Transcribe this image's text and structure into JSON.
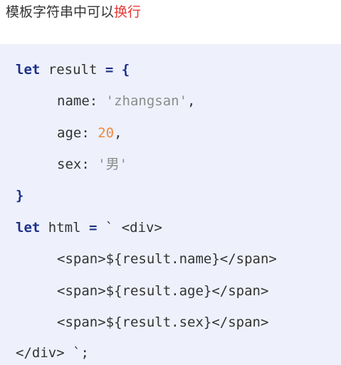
{
  "heading": {
    "prefix": "模板字符串中可以",
    "highlight": "换行"
  },
  "code": {
    "line1": {
      "kw": "let",
      "name": " result ",
      "op": "=",
      "brace": " {"
    },
    "line2": {
      "key": "name: ",
      "value": "'zhangsan'",
      "end": ","
    },
    "line3": {
      "key": "age: ",
      "value": "20",
      "end": ","
    },
    "line4": {
      "key": "sex: ",
      "value": "'男'"
    },
    "line5": {
      "text": "}"
    },
    "line6": {
      "kw": "let",
      "name": " html ",
      "op": "=",
      "rest": " ` <div>"
    },
    "line7": {
      "text": "<span>${result.name}</span>"
    },
    "line8": {
      "text": "<span>${result.age}</span>"
    },
    "line9": {
      "text": "<span>${result.sex}</span>"
    },
    "line10": {
      "text": "</div> `;"
    }
  },
  "colors": {
    "keyword": "#1c2f8a",
    "string": "#8c8c8c",
    "number": "#f0883e",
    "highlight": "#e53935",
    "code_background": "#eef1fb"
  }
}
